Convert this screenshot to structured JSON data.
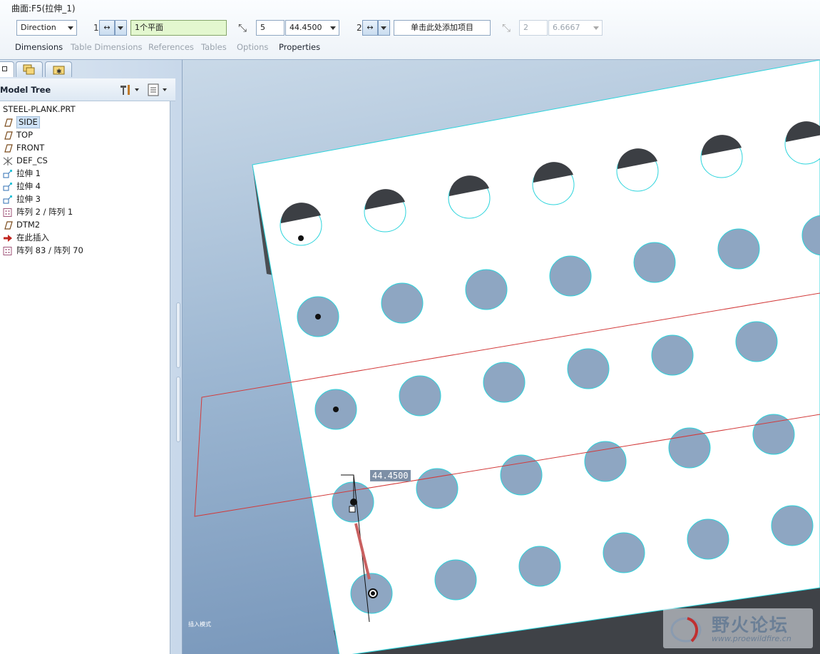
{
  "dashboard": {
    "feature_title": "曲面:F5(拉伸_1)",
    "direction_select": "Direction",
    "dir1": {
      "index": "1",
      "ref_value": "1个平面",
      "count": "5",
      "spacing": "44.4500"
    },
    "dir2": {
      "index": "2",
      "ref_placeholder": "单击此处添加项目",
      "count": "2",
      "spacing": "6.6667"
    },
    "tabs": [
      {
        "label": "Dimensions",
        "enabled": true
      },
      {
        "label": "Table Dimensions",
        "enabled": false
      },
      {
        "label": "References",
        "enabled": false
      },
      {
        "label": "Tables",
        "enabled": false
      },
      {
        "label": "Options",
        "enabled": false
      },
      {
        "label": "Properties",
        "enabled": true
      }
    ]
  },
  "navigator": {
    "title": "Model Tree",
    "items": [
      {
        "label": "STEEL-PLANK.PRT",
        "icon": "part-icon"
      },
      {
        "label": "SIDE",
        "icon": "datum-plane-icon",
        "selected": true
      },
      {
        "label": "TOP",
        "icon": "datum-plane-icon"
      },
      {
        "label": "FRONT",
        "icon": "datum-plane-icon"
      },
      {
        "label": "DEF_CS",
        "icon": "coordinate-system-icon"
      },
      {
        "label": "拉伸 1",
        "icon": "extrude-icon"
      },
      {
        "label": "拉伸 4",
        "icon": "extrude-icon"
      },
      {
        "label": "拉伸 3",
        "icon": "extrude-icon"
      },
      {
        "label": "阵列 2 / 阵列 1",
        "icon": "pattern-icon"
      },
      {
        "label": "DTM2",
        "icon": "datum-plane-icon"
      },
      {
        "label": "在此插入",
        "icon": "insert-here-arrow-icon"
      },
      {
        "label": "阵列 83 / 阵列 70",
        "icon": "pattern-icon"
      }
    ]
  },
  "graphics": {
    "dimension_value": "44.4500",
    "mode_text": "插入模式",
    "watermark": {
      "title": "野火论坛",
      "url": "www.proewildfire.cn"
    }
  },
  "colors": {
    "pattern_edge": "#2bd4dc",
    "hole_fill": "#8ea6c2",
    "datum_plane": "#d23a3a",
    "drag_arrow": "#c96060"
  }
}
